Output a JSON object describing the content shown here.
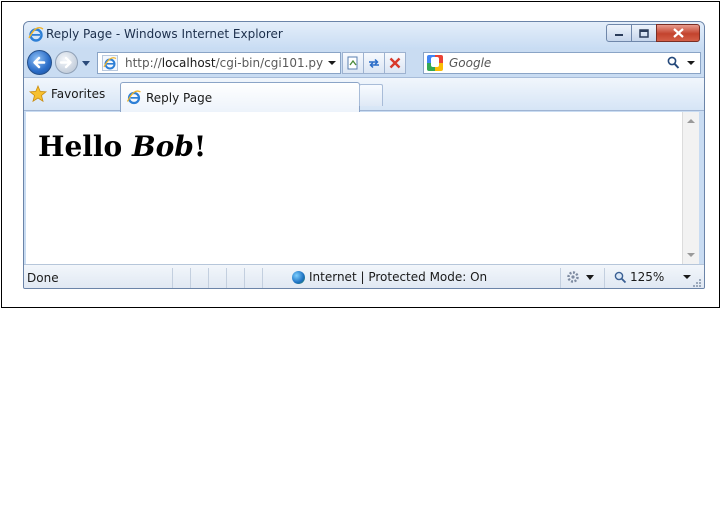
{
  "window": {
    "title": "Reply Page - Windows Internet Explorer",
    "controls": [
      "minimize",
      "restore",
      "close"
    ]
  },
  "navigation": {
    "address": "http://localhost/cgi-bin/cgi101.py",
    "address_host": "localhost",
    "address_prefix": "http://",
    "address_path": "/cgi-bin/cgi101.py",
    "search_placeholder": "Google"
  },
  "favorites_bar": {
    "favorites_label": "Favorites",
    "tab_label": "Reply Page"
  },
  "page": {
    "greeting_prefix": "Hello ",
    "greeting_name": "Bob",
    "greeting_suffix": "!"
  },
  "status_bar": {
    "status": "Done",
    "zone": "Internet | Protected Mode: On",
    "zoom": "125%"
  },
  "colors": {
    "title_text": "#1c2f4c",
    "close_button": "#c3432e",
    "back_button": "#2a6cc7"
  }
}
